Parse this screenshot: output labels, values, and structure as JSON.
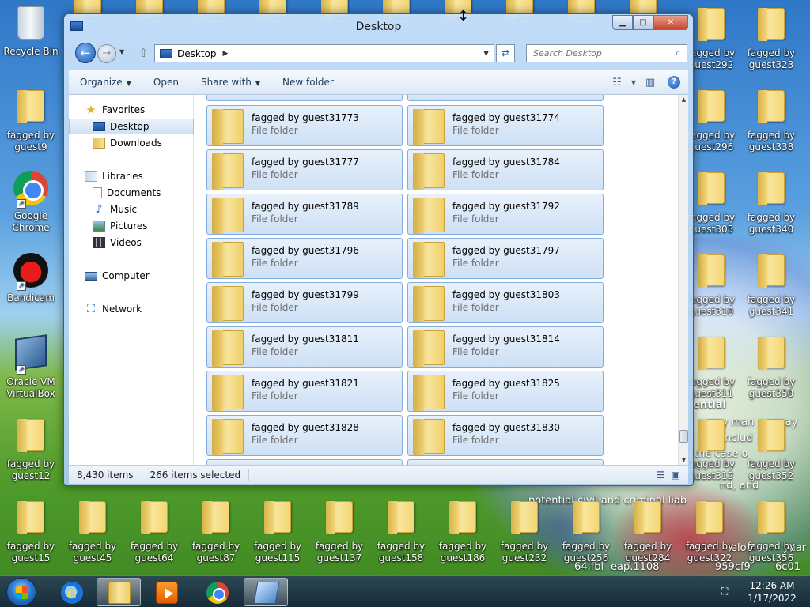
{
  "desktop": {
    "icons": {
      "recycle_bin": "Recycle Bin",
      "guest9": "fagged by\nguest9",
      "chrome": "Google\nChrome",
      "bandicam": "Bandicam",
      "vbox": "Oracle VM\nVirtualBox",
      "guest12": "fagged by\nguest12",
      "guest292": "fagged by\nguest292",
      "guest323": "fagged by\nguest323",
      "guest296": "fagged by\nguest296",
      "guest338": "fagged by\nguest338",
      "guest305": "fagged by\nguest305",
      "guest340": "fagged by\nguest340",
      "guest310": "fagged by\nguest310",
      "guest341": "fagged by\nguest341",
      "guest311": "fagged by\nguest311",
      "guest350": "fagged by\nguest350",
      "guest312": "fagged by\nguest312",
      "guest352": "fagged by\nguest352",
      "bottom": [
        "fagged by\nguest15",
        "fagged by\nguest45",
        "fagged by\nguest64",
        "fagged by\nguest87",
        "fagged by\nguest115",
        "fagged by\nguest137",
        "fagged by\nguest158",
        "fagged by\nguest186",
        "fagged by\nguest232",
        "fagged by\nguest256",
        "fagged by\nguest284",
        "fagged by\nguest322",
        "fagged by\nguest356"
      ]
    },
    "wallpaper_text": {
      "line1": "ential",
      "line2": "my man",
      "line2b": "may",
      "line3": "d includ",
      "line4": "the case o",
      "line5": "nd, and",
      "line6": "potential civil and criminal liab",
      "line7": "64.fbl",
      "line7b": "eap.1108",
      "line7c": "959cf9",
      "line7d": "6c01",
      "line8": "elop",
      "line8b": "year"
    }
  },
  "window": {
    "title": "Desktop",
    "address": "Desktop",
    "search_placeholder": "Search Desktop",
    "toolbar": {
      "organize": "Organize",
      "open": "Open",
      "share_with": "Share with",
      "new_folder": "New folder"
    },
    "nav_pane": {
      "favorites": "Favorites",
      "desktop": "Desktop",
      "downloads": "Downloads",
      "libraries": "Libraries",
      "documents": "Documents",
      "music": "Music",
      "pictures": "Pictures",
      "videos": "Videos",
      "computer": "Computer",
      "network": "Network"
    },
    "file_type": "File folder",
    "tiles": [
      [
        "fagged by guest31773",
        "fagged by guest31774"
      ],
      [
        "fagged by guest31777",
        "fagged by guest31784"
      ],
      [
        "fagged by guest31789",
        "fagged by guest31792"
      ],
      [
        "fagged by guest31796",
        "fagged by guest31797"
      ],
      [
        "fagged by guest31799",
        "fagged by guest31803"
      ],
      [
        "fagged by guest31811",
        "fagged by guest31814"
      ],
      [
        "fagged by guest31821",
        "fagged by guest31825"
      ],
      [
        "fagged by guest31828",
        "fagged by guest31830"
      ]
    ],
    "status": {
      "item_count": "8,430 items",
      "selected": "266 items selected"
    }
  },
  "taskbar": {
    "time": "12:26 AM",
    "date": "1/17/2022"
  },
  "colors": {
    "tile_border": "#84acdd",
    "tile_fill": "#cde0f5",
    "folder": "#f8e59c"
  }
}
